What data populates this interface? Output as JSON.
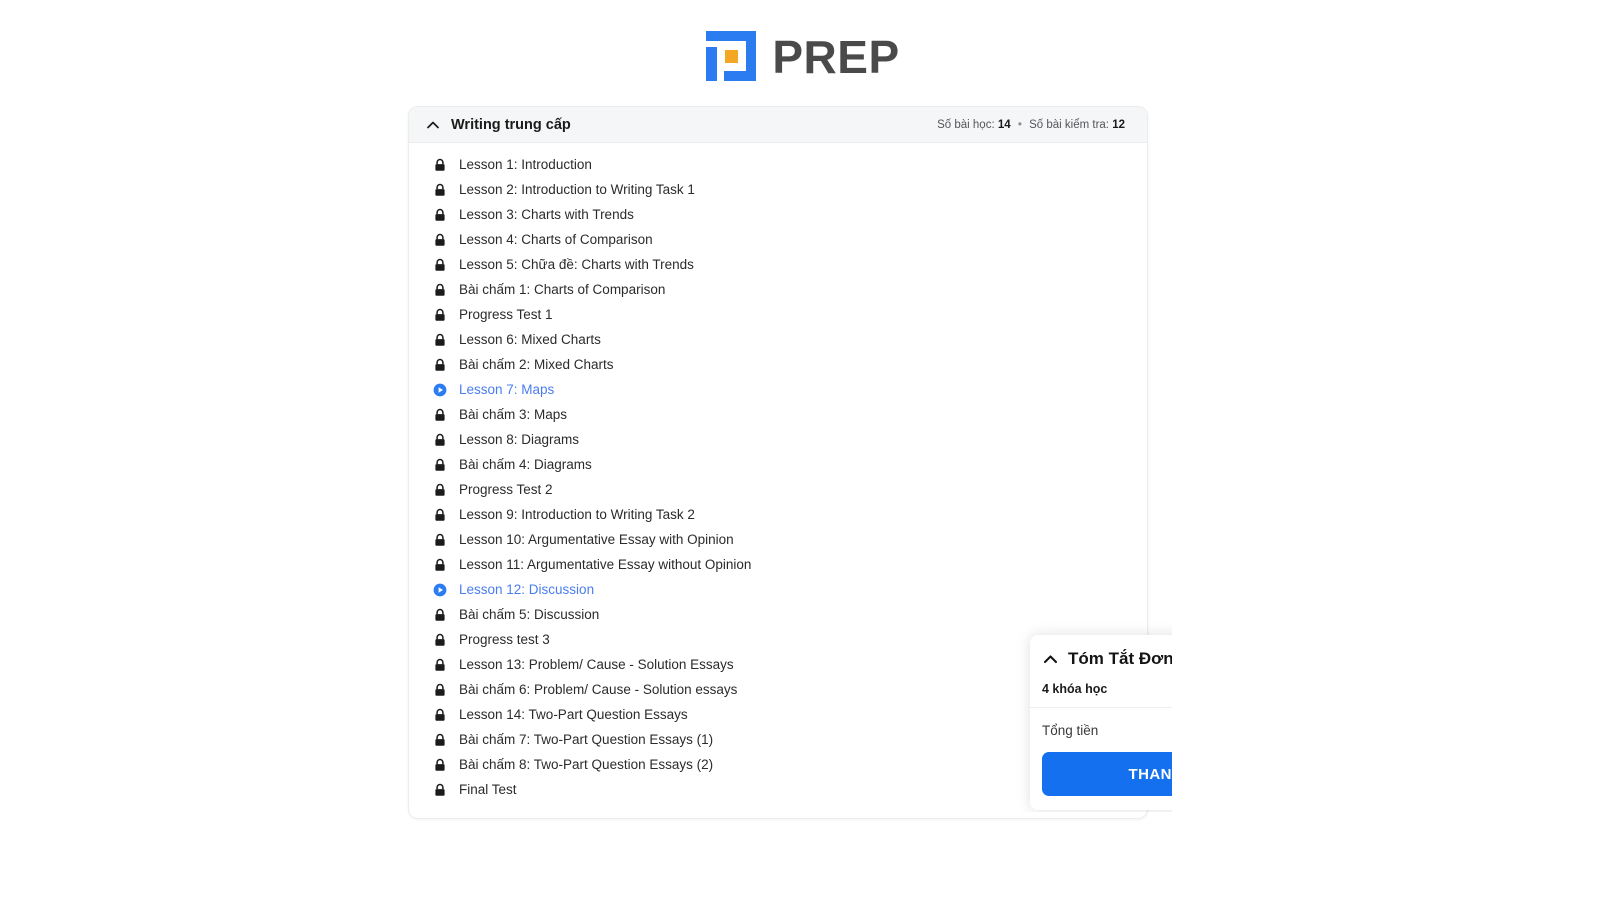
{
  "brand": {
    "name": "PREP",
    "logo_icon": "prep-logo-icon",
    "blue": "#2b7cf0",
    "orange": "#f5a623",
    "text_color": "#4a4a4a"
  },
  "course_card": {
    "collapse_icon": "chevron-up-icon",
    "title": "Writing trung cấp",
    "stats": {
      "lessons_label": "Số bài học:",
      "lessons_count": "14",
      "separator": "•",
      "tests_label": "Số bài kiểm tra:",
      "tests_count": "12"
    },
    "items": [
      {
        "label": "Lesson 1: Introduction",
        "icon": "lock-icon",
        "state": "locked"
      },
      {
        "label": "Lesson 2: Introduction to Writing Task 1",
        "icon": "lock-icon",
        "state": "locked"
      },
      {
        "label": "Lesson 3: Charts with Trends",
        "icon": "lock-icon",
        "state": "locked"
      },
      {
        "label": "Lesson 4: Charts of Comparison",
        "icon": "lock-icon",
        "state": "locked"
      },
      {
        "label": "Lesson 5: Chữa đề: Charts with Trends",
        "icon": "lock-icon",
        "state": "locked"
      },
      {
        "label": "Bài chấm 1: Charts of Comparison",
        "icon": "lock-icon",
        "state": "locked"
      },
      {
        "label": "Progress Test 1",
        "icon": "lock-icon",
        "state": "locked"
      },
      {
        "label": "Lesson 6: Mixed Charts",
        "icon": "lock-icon",
        "state": "locked"
      },
      {
        "label": "Bài chấm 2: Mixed Charts",
        "icon": "lock-icon",
        "state": "locked"
      },
      {
        "label": "Lesson 7: Maps",
        "icon": "play-circle-icon",
        "state": "unlocked"
      },
      {
        "label": "Bài chấm 3: Maps",
        "icon": "lock-icon",
        "state": "locked"
      },
      {
        "label": "Lesson 8: Diagrams",
        "icon": "lock-icon",
        "state": "locked"
      },
      {
        "label": "Bài chấm 4: Diagrams",
        "icon": "lock-icon",
        "state": "locked"
      },
      {
        "label": "Progress Test 2",
        "icon": "lock-icon",
        "state": "locked"
      },
      {
        "label": "Lesson 9: Introduction to Writing Task 2",
        "icon": "lock-icon",
        "state": "locked"
      },
      {
        "label": "Lesson 10: Argumentative Essay with Opinion",
        "icon": "lock-icon",
        "state": "locked"
      },
      {
        "label": "Lesson 11: Argumentative Essay without Opinion",
        "icon": "lock-icon",
        "state": "locked"
      },
      {
        "label": "Lesson 12: Discussion",
        "icon": "play-circle-icon",
        "state": "unlocked"
      },
      {
        "label": "Bài chấm 5: Discussion",
        "icon": "lock-icon",
        "state": "locked"
      },
      {
        "label": "Progress test 3",
        "icon": "lock-icon",
        "state": "locked"
      },
      {
        "label": "Lesson 13: Problem/ Cause - Solution Essays",
        "icon": "lock-icon",
        "state": "locked"
      },
      {
        "label": "Bài chấm 6: Problem/ Cause - Solution essays",
        "icon": "lock-icon",
        "state": "locked"
      },
      {
        "label": "Lesson 14: Two-Part Question Essays",
        "icon": "lock-icon",
        "state": "locked"
      },
      {
        "label": "Bài chấm 7: Two-Part Question Essays (1)",
        "icon": "lock-icon",
        "state": "locked"
      },
      {
        "label": "Bài chấm 8: Two-Part Question Essays (2)",
        "icon": "lock-icon",
        "state": "locked"
      },
      {
        "label": "Final Test",
        "icon": "lock-icon",
        "state": "locked"
      }
    ]
  },
  "summary_panel": {
    "collapse_icon": "chevron-up-icon",
    "title": "Tóm Tắt Đơn Hàng",
    "course_count": "4 khóa học",
    "total_label": "Tổng tiền",
    "total_value": "",
    "pay_button": "THANH TOÁN",
    "accent": "#1570f0"
  }
}
